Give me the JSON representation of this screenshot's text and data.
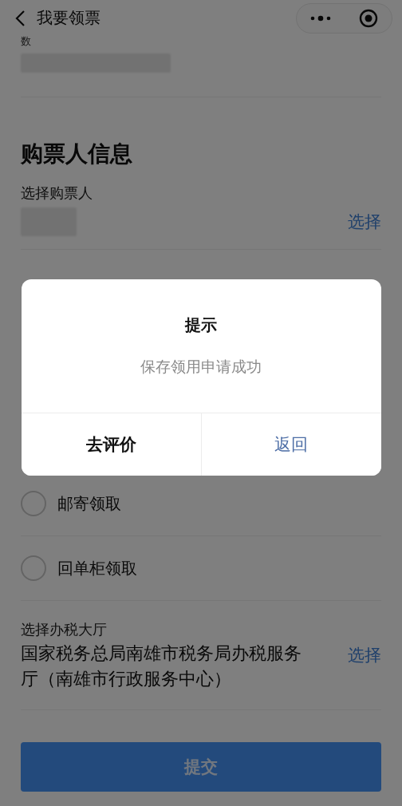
{
  "nav": {
    "title": "我要领票"
  },
  "top_field": {
    "label": "数"
  },
  "buyer_section": {
    "title": "购票人信息",
    "field_label": "选择购票人",
    "action": "选择"
  },
  "pickup_options": [
    {
      "label": "邮寄领取",
      "selected": false
    },
    {
      "label": "回单柜领取",
      "selected": false
    }
  ],
  "hall": {
    "label": "选择办税大厅",
    "value": "国家税务总局南雄市税务局办税服务厅（南雄市行政服务中心）",
    "action": "选择"
  },
  "submit": {
    "label": "提交"
  },
  "dialog": {
    "title": "提示",
    "message": "保存领用申请成功",
    "buttons": [
      {
        "label": "去评价",
        "kind": "default"
      },
      {
        "label": "返回",
        "kind": "primary"
      }
    ]
  }
}
